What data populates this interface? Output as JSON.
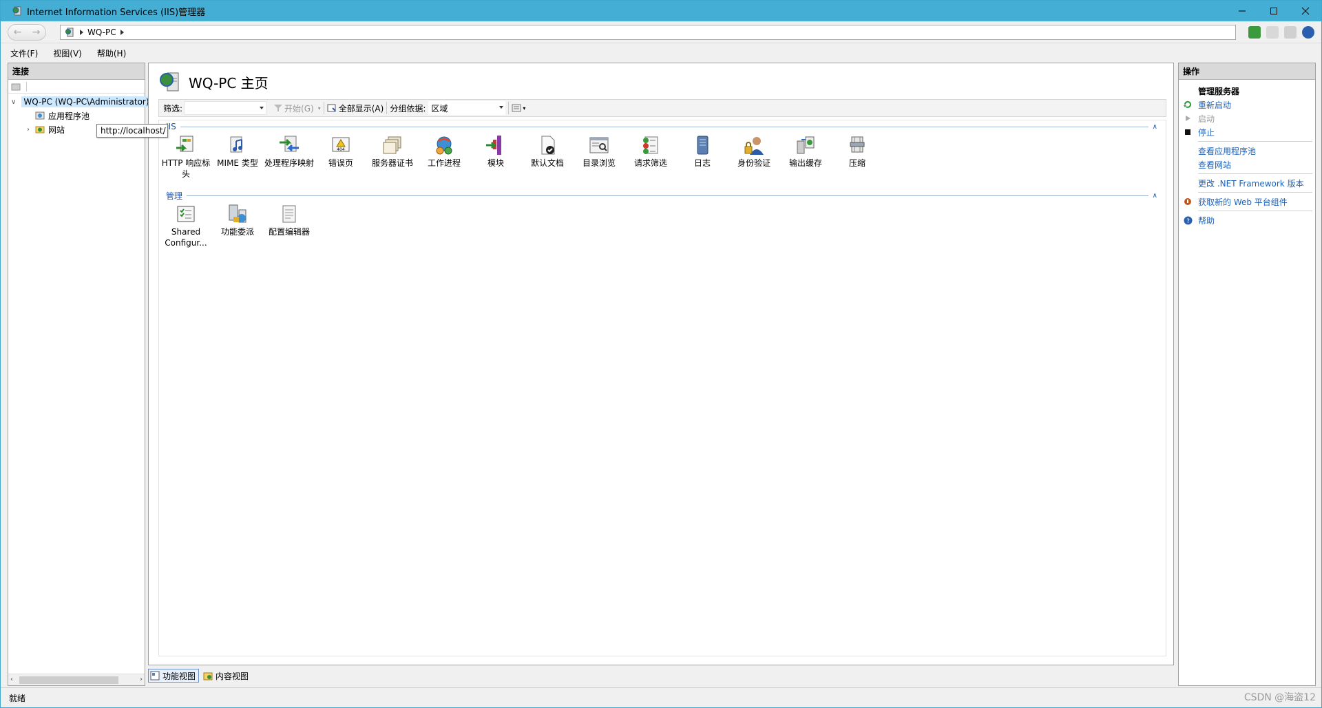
{
  "window": {
    "title": "Internet Information Services (IIS)管理器"
  },
  "address": {
    "segments": [
      "WQ-PC"
    ]
  },
  "menu": [
    "文件(F)",
    "视图(V)",
    "帮助(H)"
  ],
  "connections": {
    "header": "连接",
    "tree": [
      {
        "label": "WQ-PC (WQ-PC\\Administrator)"
      },
      {
        "label": "应用程序池"
      },
      {
        "label": "网站"
      }
    ],
    "tooltip": "http://localhost/"
  },
  "main": {
    "title": "WQ-PC 主页",
    "filter": {
      "label": "筛选:",
      "start": "开始(G)",
      "show_all": "全部显示(A)",
      "group_label": "分组依据:",
      "group_value": "区域"
    },
    "sections": [
      {
        "name": "IIS",
        "items": [
          "HTTP 响应标头",
          "MIME 类型",
          "处理程序映射",
          "错误页",
          "服务器证书",
          "工作进程",
          "模块",
          "默认文档",
          "目录浏览",
          "请求筛选",
          "日志",
          "身份验证",
          "输出缓存",
          "压缩"
        ]
      },
      {
        "name": "管理",
        "items": [
          "Shared Configur...",
          "功能委派",
          "配置编辑器"
        ]
      }
    ]
  },
  "view_tabs": [
    "功能视图",
    "内容视图"
  ],
  "actions": {
    "header": "操作",
    "group": "管理服务器",
    "restart": "重新启动",
    "start": "启动",
    "stop": "停止",
    "view_pools": "查看应用程序池",
    "view_sites": "查看网站",
    "change_framework": "更改 .NET Framework 版本",
    "get_components": "获取新的 Web 平台组件",
    "help": "帮助"
  },
  "status": {
    "text": "就绪"
  },
  "watermark": "CSDN @海盗12"
}
